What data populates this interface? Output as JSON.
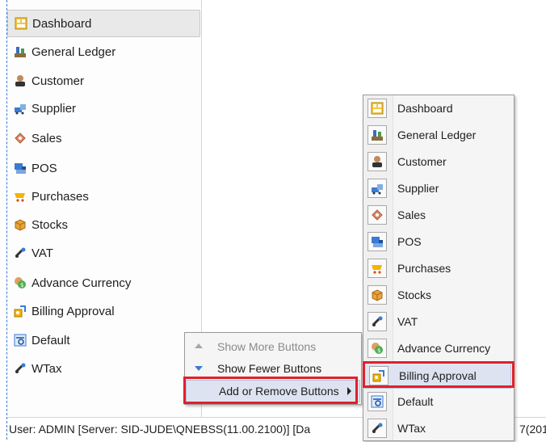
{
  "sidebar": {
    "items": [
      {
        "label": "Dashboard",
        "icon": "dashboard-icon"
      },
      {
        "label": "General Ledger",
        "icon": "ledger-icon"
      },
      {
        "label": "Customer",
        "icon": "customer-icon"
      },
      {
        "label": "Supplier",
        "icon": "supplier-icon"
      },
      {
        "label": "Sales",
        "icon": "sales-icon"
      },
      {
        "label": "POS",
        "icon": "pos-icon"
      },
      {
        "label": "Purchases",
        "icon": "purchases-icon"
      },
      {
        "label": "Stocks",
        "icon": "stocks-icon"
      },
      {
        "label": "VAT",
        "icon": "vat-icon"
      },
      {
        "label": "Advance Currency",
        "icon": "currency-icon"
      },
      {
        "label": "Billing Approval",
        "icon": "billing-icon"
      },
      {
        "label": "Default",
        "icon": "default-icon"
      },
      {
        "label": "WTax",
        "icon": "wtax-icon"
      }
    ]
  },
  "context_menu": {
    "show_more": "Show More Buttons",
    "show_fewer": "Show Fewer Buttons",
    "add_remove": "Add or Remove Buttons"
  },
  "submenu": {
    "items": [
      {
        "label": "Dashboard"
      },
      {
        "label": "General Ledger"
      },
      {
        "label": "Customer"
      },
      {
        "label": "Supplier"
      },
      {
        "label": "Sales"
      },
      {
        "label": "POS"
      },
      {
        "label": "Purchases"
      },
      {
        "label": "Stocks"
      },
      {
        "label": "VAT"
      },
      {
        "label": "Advance Currency"
      },
      {
        "label": "Billing Approval"
      },
      {
        "label": "Default"
      },
      {
        "label": "WTax"
      }
    ]
  },
  "statusbar": {
    "text": "User: ADMIN   [Server: SID-JUDE\\QNEBSS(11.00.2100)]   [Da",
    "tail": "7(201"
  },
  "colors": {
    "highlight_border": "#e0202a",
    "hover_bg": "#dde3f0"
  }
}
